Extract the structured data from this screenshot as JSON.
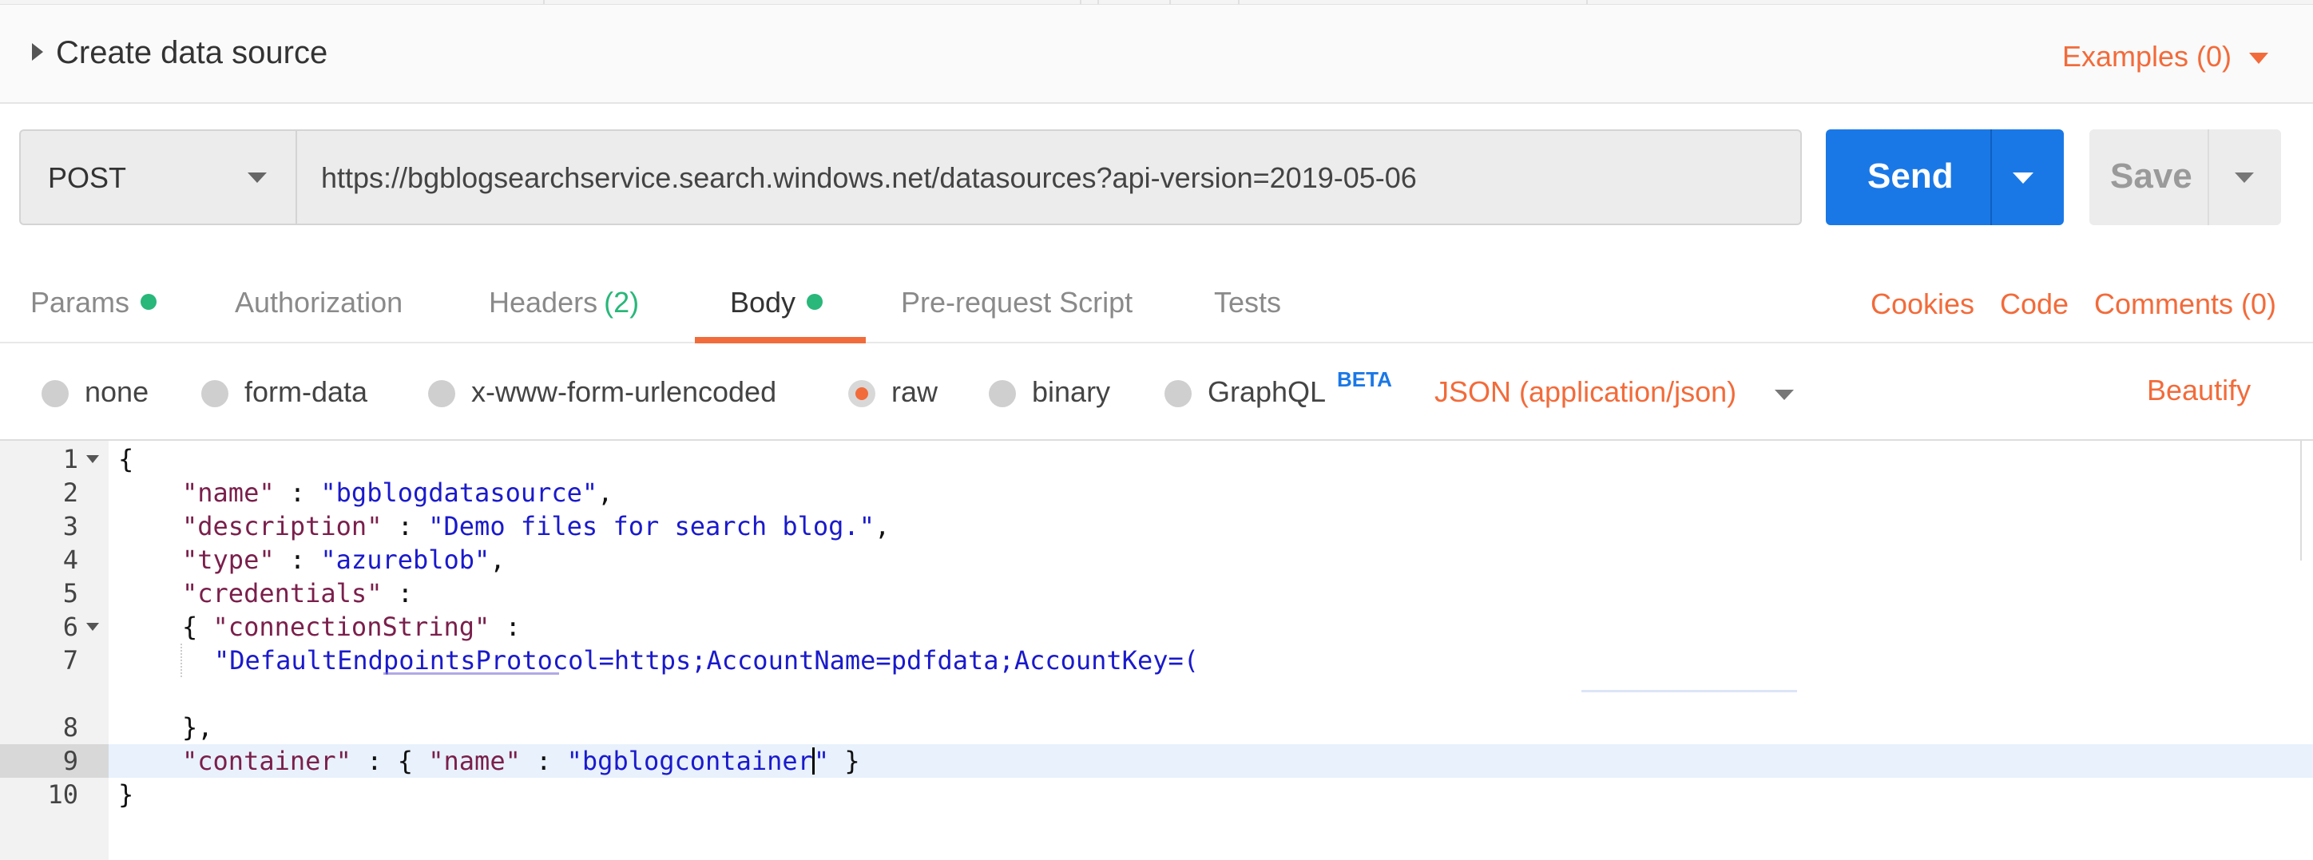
{
  "header": {
    "title": "Create data source",
    "examples_label": "Examples (0)"
  },
  "request": {
    "method": "POST",
    "url": "https://bgblogsearchservice.search.windows.net/datasources?api-version=2019-05-06",
    "send_label": "Send",
    "save_label": "Save"
  },
  "tabs": [
    {
      "label": "Params",
      "indicator": "dot"
    },
    {
      "label": "Authorization"
    },
    {
      "label": "Headers",
      "count": "(2)"
    },
    {
      "label": "Body",
      "indicator": "dot",
      "active": true
    },
    {
      "label": "Pre-request Script"
    },
    {
      "label": "Tests"
    }
  ],
  "right_links": {
    "cookies": "Cookies",
    "code": "Code",
    "comments": "Comments (0)"
  },
  "body_types": {
    "none": "none",
    "form_data": "form-data",
    "urlencoded": "x-www-form-urlencoded",
    "raw": "raw",
    "binary": "binary",
    "graphql": "GraphQL",
    "beta": "BETA",
    "selected": "raw",
    "content_type": "JSON (application/json)",
    "beautify": "Beautify"
  },
  "editor": {
    "line_numbers": [
      "1",
      "2",
      "3",
      "4",
      "5",
      "6",
      "7",
      "8",
      "9",
      "10"
    ],
    "lines": {
      "l1": "{",
      "l2_key": "\"name\"",
      "l2_sep": " : ",
      "l2_val": "\"bgblogdatasource\"",
      "l2_end": ",",
      "l3_key": "\"description\"",
      "l3_sep": " : ",
      "l3_val": "\"Demo files for search blog.\"",
      "l3_end": ",",
      "l4_key": "\"type\"",
      "l4_sep": " : ",
      "l4_val": "\"azureblob\"",
      "l4_end": ",",
      "l5_key": "\"credentials\"",
      "l5_sep": " :",
      "l6_open": "{ ",
      "l6_key": "\"connectionString\"",
      "l6_sep": " :",
      "l7_val": "\"DefaultEndpointsProtocol=https;AccountName=pdfdata;AccountKey=(",
      "l8": "},",
      "l9_key": "\"container\"",
      "l9_sep": " : { ",
      "l9_key2": "\"name\"",
      "l9_sep2": " : ",
      "l9_val_a": "\"bgblogcontainer",
      "l9_val_b": "\"",
      "l9_end": " }",
      "l10": "}"
    },
    "highlighted_line": "9"
  },
  "colors": {
    "accent": "#f26b3a",
    "send_blue": "#1a78e6",
    "status_green": "#29b77a",
    "json_key": "#7a1f4b",
    "json_string": "#1a1acc"
  }
}
